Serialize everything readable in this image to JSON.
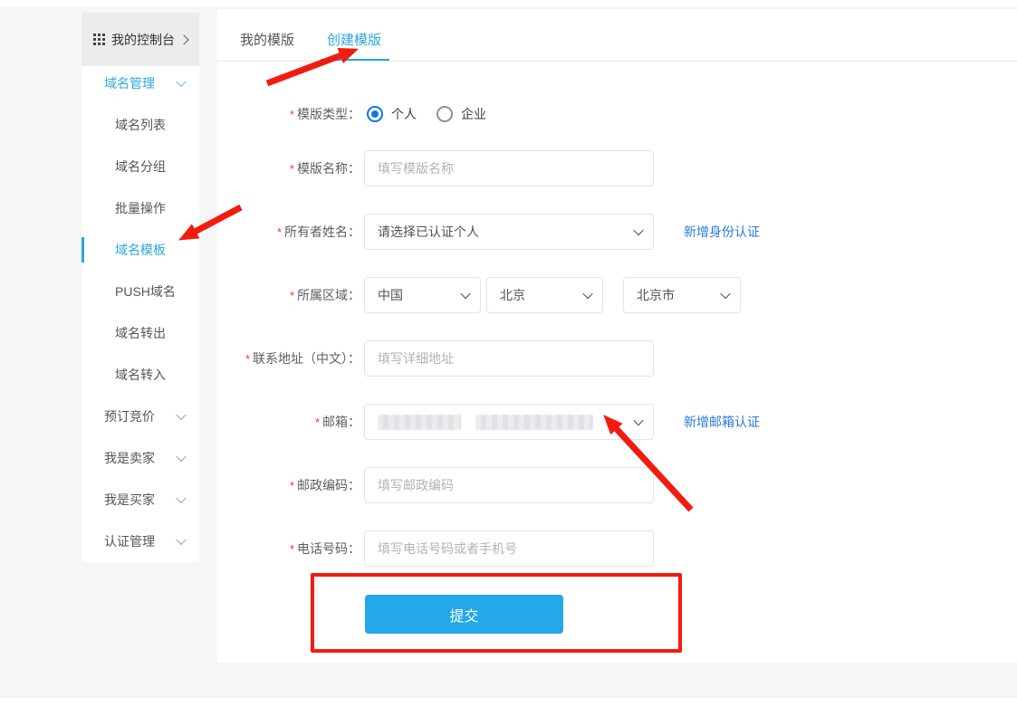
{
  "colors": {
    "accent_blue": "#2aa7e0",
    "button_blue": "#23a8e8",
    "link_blue": "#2a79e3",
    "annotation_red": "#f11c0f",
    "radio_blue": "#1673e6"
  },
  "sidebar": {
    "header": {
      "label": "我的控制台"
    },
    "items": [
      {
        "label": "域名管理",
        "kind": "group",
        "highlighted": true,
        "expanded": true
      },
      {
        "label": "域名列表",
        "kind": "sub"
      },
      {
        "label": "域名分组",
        "kind": "sub"
      },
      {
        "label": "批量操作",
        "kind": "sub"
      },
      {
        "label": "域名模板",
        "kind": "sub",
        "active": true
      },
      {
        "label": "PUSH域名",
        "kind": "sub"
      },
      {
        "label": "域名转出",
        "kind": "sub"
      },
      {
        "label": "域名转入",
        "kind": "sub"
      },
      {
        "label": "预订竞价",
        "kind": "group"
      },
      {
        "label": "我是卖家",
        "kind": "group"
      },
      {
        "label": "我是买家",
        "kind": "group"
      },
      {
        "label": "认证管理",
        "kind": "group"
      }
    ]
  },
  "tabs": [
    {
      "label": "我的模版",
      "active": false
    },
    {
      "label": "创建模版",
      "active": true
    }
  ],
  "form": {
    "required_marker": "*",
    "template_type": {
      "label": "模版类型：",
      "options": [
        {
          "label": "个人",
          "selected": true
        },
        {
          "label": "企业",
          "selected": false
        }
      ]
    },
    "template_name": {
      "label": "模版名称：",
      "placeholder": "填写模版名称"
    },
    "owner_name": {
      "label": "所有者姓名：",
      "value": "请选择已认证个人",
      "link": "新增身份认证"
    },
    "region": {
      "label": "所属区域：",
      "selects": [
        "中国",
        "北京",
        "北京市"
      ]
    },
    "address_cn": {
      "label": "联系地址（中文）：",
      "placeholder": "填写详细地址"
    },
    "email": {
      "label": "邮箱：",
      "masked": true,
      "link": "新增邮箱认证"
    },
    "postal_code": {
      "label": "邮政编码：",
      "placeholder": "填写邮政编码"
    },
    "phone": {
      "label": "电话号码：",
      "placeholder": "填写电话号码或者手机号"
    },
    "submit_label": "提交"
  }
}
